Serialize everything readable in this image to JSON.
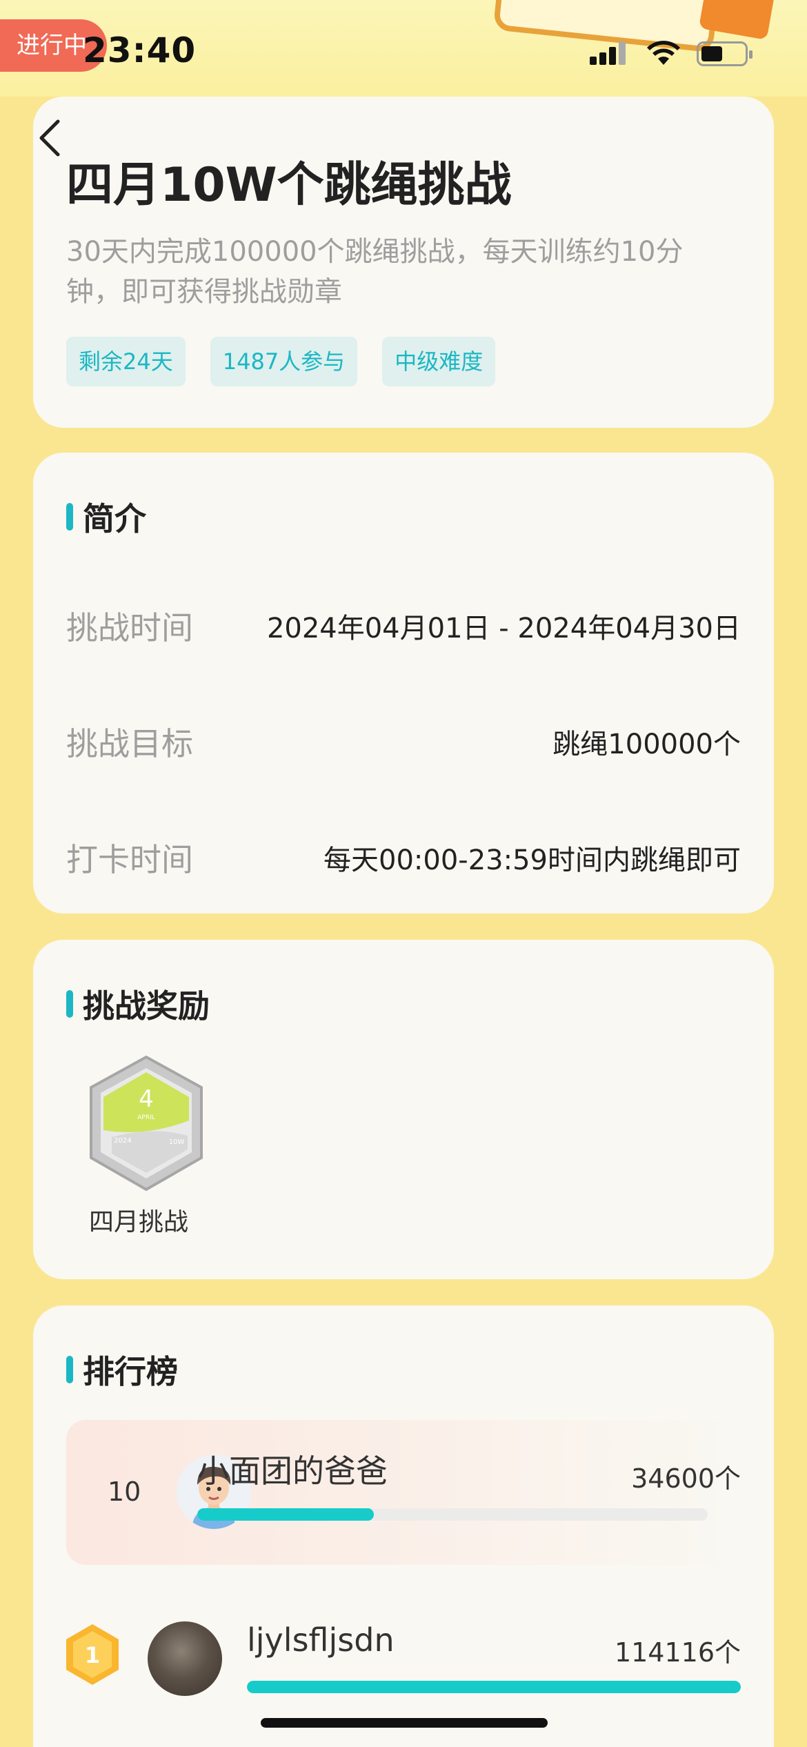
{
  "status_bar": {
    "live_pill": "进行中",
    "time": "23:40"
  },
  "header": {
    "title": "四月10W个跳绳挑战",
    "description": "30天内完成100000个跳绳挑战，每天训练约10分钟，即可获得挑战勋章",
    "tags": [
      "剩余24天",
      "1487人参与",
      "中级难度"
    ]
  },
  "intro": {
    "heading": "简介",
    "rows": [
      {
        "label": "挑战时间",
        "value": "2024年04月01日 - 2024年04月30日"
      },
      {
        "label": "挑战目标",
        "value": "跳绳100000个"
      },
      {
        "label": "打卡时间",
        "value": "每天00:00-23:59时间内跳绳即可"
      }
    ]
  },
  "reward": {
    "heading": "挑战奖励",
    "medal_label": "四月挑战",
    "medal_text": {
      "month": "4",
      "sub": "APRIL",
      "year": "2024",
      "target": "10W"
    }
  },
  "leaderboard": {
    "heading": "排行榜",
    "me": {
      "rank": "10",
      "name": "小面团的爸爸",
      "count": "34600个",
      "progress": 0.346
    },
    "entries": [
      {
        "rank": "1",
        "name": "ljylsfljsdn",
        "count": "114116个",
        "progress": 1.0
      }
    ]
  },
  "colors": {
    "accent": "#1bb7c4",
    "progress": "#16cbc9",
    "page_bg": "#fae691",
    "card_bg": "#f9f8f2",
    "pill": "#f06a56"
  }
}
